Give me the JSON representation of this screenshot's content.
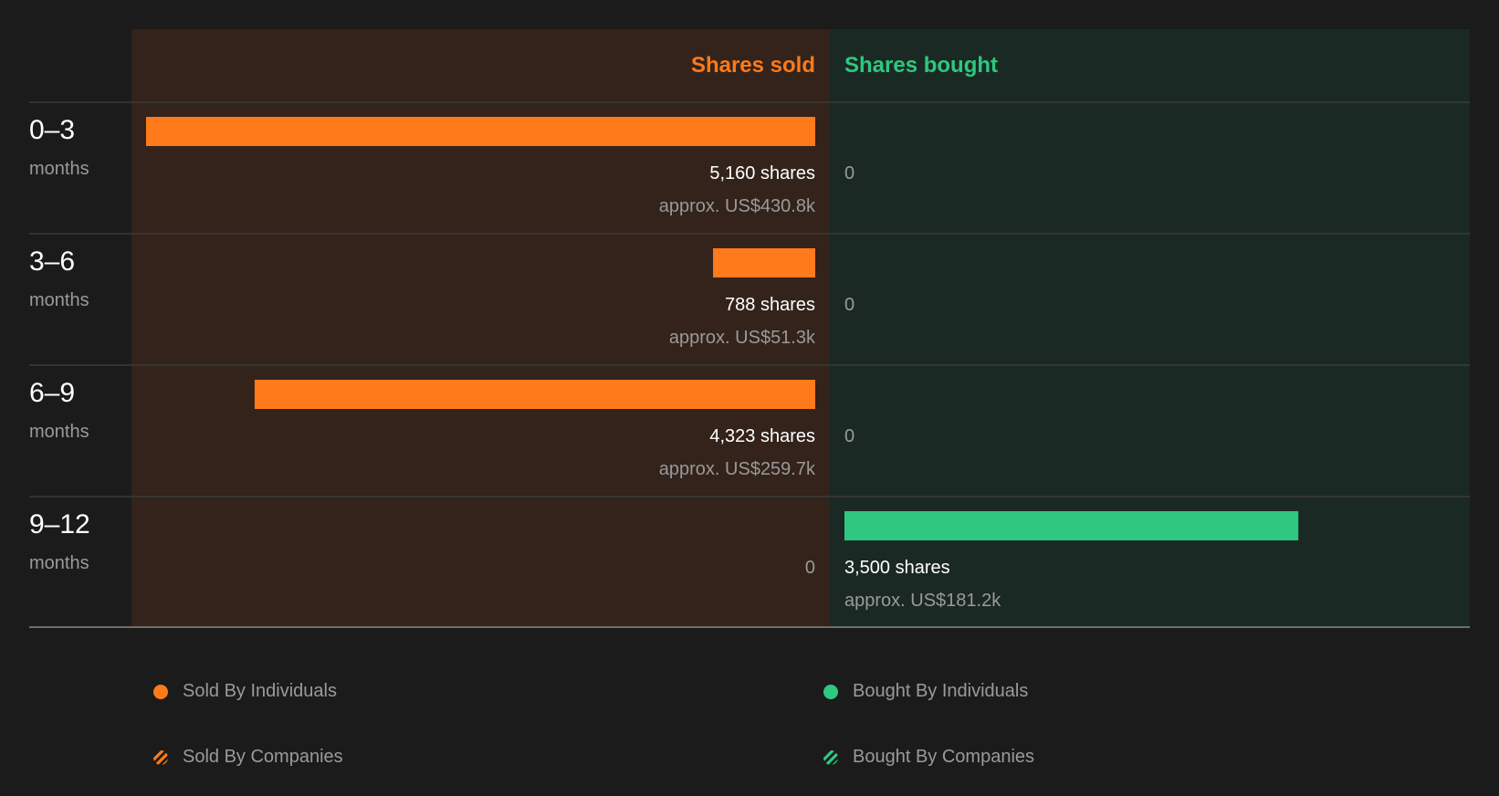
{
  "chart_data": {
    "type": "bar",
    "orientation": "horizontal-diverging",
    "headers": {
      "sold": "Shares sold",
      "bought": "Shares bought"
    },
    "rows": [
      {
        "range": "0–3",
        "unit": "months",
        "sold_shares": 5160,
        "sold_label": "5,160 shares",
        "sold_value": "approx. US$430.8k",
        "bought_shares": 0,
        "bought_label": "0",
        "bought_value": ""
      },
      {
        "range": "3–6",
        "unit": "months",
        "sold_shares": 788,
        "sold_label": "788 shares",
        "sold_value": "approx. US$51.3k",
        "bought_shares": 0,
        "bought_label": "0",
        "bought_value": ""
      },
      {
        "range": "6–9",
        "unit": "months",
        "sold_shares": 4323,
        "sold_label": "4,323 shares",
        "sold_value": "approx. US$259.7k",
        "bought_shares": 0,
        "bought_label": "0",
        "bought_value": ""
      },
      {
        "range": "9–12",
        "unit": "months",
        "sold_shares": 0,
        "sold_label": "0",
        "sold_value": "",
        "bought_shares": 3500,
        "bought_label": "3,500 shares",
        "bought_value": "approx. US$181.2k"
      }
    ],
    "max_shares": 5160,
    "colors": {
      "sold": "#ff7a1a",
      "bought": "#2ec880",
      "sold_bg": "#33231b",
      "bought_bg": "#1b2924"
    }
  },
  "legend": {
    "sold_individuals": "Sold By Individuals",
    "bought_individuals": "Bought By Individuals",
    "sold_companies": "Sold By Companies",
    "bought_companies": "Bought By Companies"
  }
}
